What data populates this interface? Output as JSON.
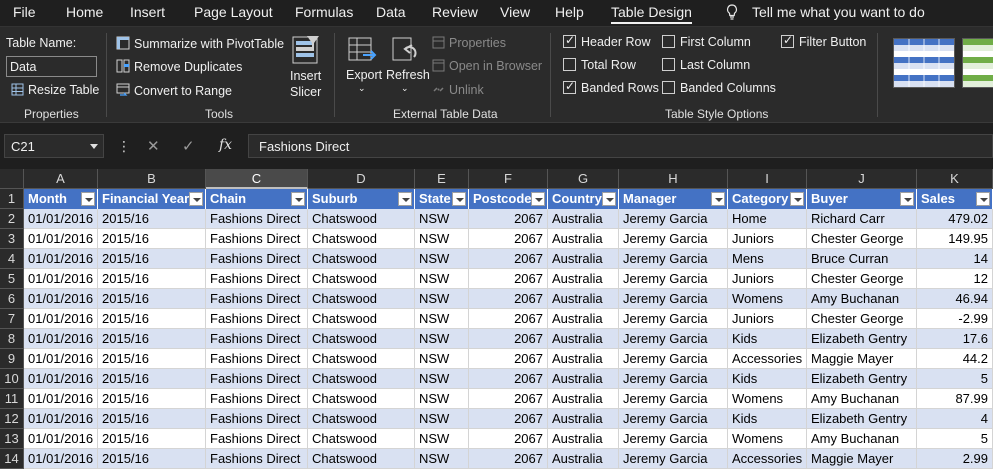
{
  "menu": {
    "items": [
      {
        "label": "File",
        "active": false
      },
      {
        "label": "Home",
        "active": false
      },
      {
        "label": "Insert",
        "active": false
      },
      {
        "label": "Page Layout",
        "active": false
      },
      {
        "label": "Formulas",
        "active": false
      },
      {
        "label": "Data",
        "active": false
      },
      {
        "label": "Review",
        "active": false
      },
      {
        "label": "View",
        "active": false
      },
      {
        "label": "Help",
        "active": false
      },
      {
        "label": "Table Design",
        "active": true
      }
    ],
    "tell_me": "Tell me what you want to do"
  },
  "ribbon": {
    "properties": {
      "table_name_label": "Table Name:",
      "table_name_value": "Data",
      "resize_table": "Resize Table",
      "group_label": "Properties"
    },
    "tools": {
      "summarize_pivot": "Summarize with PivotTable",
      "remove_duplicates": "Remove Duplicates",
      "convert_to_range": "Convert to Range",
      "insert_slicer_line1": "Insert",
      "insert_slicer_line2": "Slicer",
      "group_label": "Tools"
    },
    "external": {
      "export": "Export",
      "refresh": "Refresh",
      "properties": "Properties",
      "open_in_browser": "Open in Browser",
      "unlink": "Unlink",
      "group_label": "External Table Data"
    },
    "style_options": {
      "header_row": {
        "label": "Header Row",
        "checked": true
      },
      "total_row": {
        "label": "Total Row",
        "checked": false
      },
      "banded_rows": {
        "label": "Banded Rows",
        "checked": true
      },
      "first_column": {
        "label": "First Column",
        "checked": false
      },
      "last_column": {
        "label": "Last Column",
        "checked": false
      },
      "banded_columns": {
        "label": "Banded Columns",
        "checked": false
      },
      "filter_button": {
        "label": "Filter Button",
        "checked": true
      },
      "group_label": "Table Style Options"
    }
  },
  "formula_bar": {
    "name_box": "C21",
    "fx": "fx",
    "content": "Fashions Direct"
  },
  "grid": {
    "column_letters": [
      "A",
      "B",
      "C",
      "D",
      "E",
      "F",
      "G",
      "H",
      "I",
      "J",
      "K"
    ],
    "selected_column": "C",
    "row_numbers": [
      "1",
      "2",
      "3",
      "4",
      "5",
      "6",
      "7",
      "8",
      "9",
      "10",
      "11",
      "12",
      "13",
      "14"
    ],
    "headers": [
      "Month",
      "Financial Year",
      "Chain",
      "Suburb",
      "State",
      "Postcode",
      "Country",
      "Manager",
      "Category",
      "Buyer",
      "Sales"
    ],
    "rows": [
      [
        "01/01/2016",
        "2015/16",
        "Fashions Direct",
        "Chatswood",
        "NSW",
        "2067",
        "Australia",
        "Jeremy Garcia",
        "Home",
        "Richard Carr",
        "479.02"
      ],
      [
        "01/01/2016",
        "2015/16",
        "Fashions Direct",
        "Chatswood",
        "NSW",
        "2067",
        "Australia",
        "Jeremy Garcia",
        "Juniors",
        "Chester George",
        "149.95"
      ],
      [
        "01/01/2016",
        "2015/16",
        "Fashions Direct",
        "Chatswood",
        "NSW",
        "2067",
        "Australia",
        "Jeremy Garcia",
        "Mens",
        "Bruce Curran",
        "14"
      ],
      [
        "01/01/2016",
        "2015/16",
        "Fashions Direct",
        "Chatswood",
        "NSW",
        "2067",
        "Australia",
        "Jeremy Garcia",
        "Juniors",
        "Chester George",
        "12"
      ],
      [
        "01/01/2016",
        "2015/16",
        "Fashions Direct",
        "Chatswood",
        "NSW",
        "2067",
        "Australia",
        "Jeremy Garcia",
        "Womens",
        "Amy Buchanan",
        "46.94"
      ],
      [
        "01/01/2016",
        "2015/16",
        "Fashions Direct",
        "Chatswood",
        "NSW",
        "2067",
        "Australia",
        "Jeremy Garcia",
        "Juniors",
        "Chester George",
        "-2.99"
      ],
      [
        "01/01/2016",
        "2015/16",
        "Fashions Direct",
        "Chatswood",
        "NSW",
        "2067",
        "Australia",
        "Jeremy Garcia",
        "Kids",
        "Elizabeth Gentry",
        "17.6"
      ],
      [
        "01/01/2016",
        "2015/16",
        "Fashions Direct",
        "Chatswood",
        "NSW",
        "2067",
        "Australia",
        "Jeremy Garcia",
        "Accessories",
        "Maggie Mayer",
        "44.2"
      ],
      [
        "01/01/2016",
        "2015/16",
        "Fashions Direct",
        "Chatswood",
        "NSW",
        "2067",
        "Australia",
        "Jeremy Garcia",
        "Kids",
        "Elizabeth Gentry",
        "5"
      ],
      [
        "01/01/2016",
        "2015/16",
        "Fashions Direct",
        "Chatswood",
        "NSW",
        "2067",
        "Australia",
        "Jeremy Garcia",
        "Womens",
        "Amy Buchanan",
        "87.99"
      ],
      [
        "01/01/2016",
        "2015/16",
        "Fashions Direct",
        "Chatswood",
        "NSW",
        "2067",
        "Australia",
        "Jeremy Garcia",
        "Kids",
        "Elizabeth Gentry",
        "4"
      ],
      [
        "01/01/2016",
        "2015/16",
        "Fashions Direct",
        "Chatswood",
        "NSW",
        "2067",
        "Australia",
        "Jeremy Garcia",
        "Womens",
        "Amy Buchanan",
        "5"
      ],
      [
        "01/01/2016",
        "2015/16",
        "Fashions Direct",
        "Chatswood",
        "NSW",
        "2067",
        "Australia",
        "Jeremy Garcia",
        "Accessories",
        "Maggie Mayer",
        "2.99"
      ]
    ],
    "numeric_columns": [
      5,
      10
    ],
    "colors": {
      "header_fill": "#4472c4",
      "band_fill": "#d9e1f2",
      "header_text": "#ffffff"
    }
  }
}
